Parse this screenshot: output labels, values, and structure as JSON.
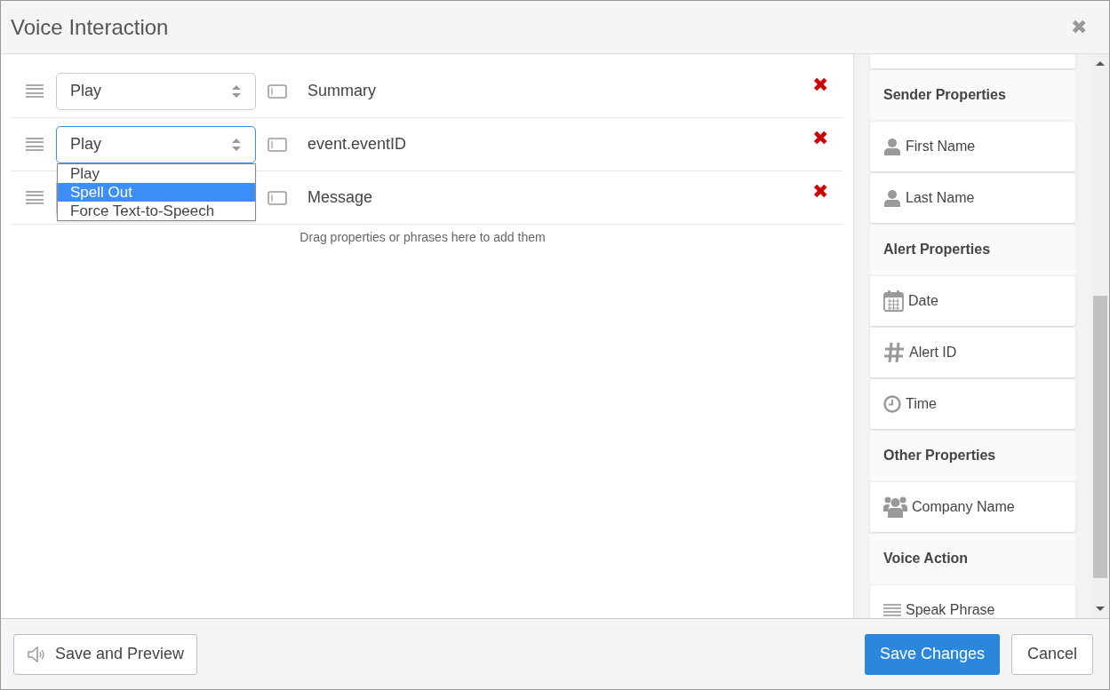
{
  "window": {
    "title": "Voice Interaction",
    "close": "✖"
  },
  "rows": [
    {
      "mode": "Play",
      "field": "Summary",
      "focused": false,
      "remove": "✖"
    },
    {
      "mode": "Play",
      "field": "event.eventID",
      "focused": true,
      "remove": "✖",
      "dropdown": [
        {
          "label": "Play",
          "selected": false
        },
        {
          "label": "Spell Out",
          "selected": true
        },
        {
          "label": "Force Text-to-Speech",
          "selected": false
        }
      ]
    },
    {
      "field": "Message",
      "focused": false,
      "remove": "✖"
    }
  ],
  "drop_hint": "Drag properties or phrases here to add them",
  "sidebar": {
    "groups": [
      {
        "title": "Sender Properties",
        "items": [
          {
            "label": "First Name",
            "kind": "person"
          },
          {
            "label": "Last Name",
            "kind": "person"
          }
        ]
      },
      {
        "title": "Alert Properties",
        "items": [
          {
            "label": "Date",
            "kind": "calendar"
          },
          {
            "label": "Alert ID",
            "kind": "hash"
          },
          {
            "label": "Time",
            "kind": "clock"
          }
        ]
      },
      {
        "title": "Other Properties",
        "items": [
          {
            "label": "Company Name",
            "kind": "group"
          }
        ]
      },
      {
        "title": "Voice Action",
        "items": [
          {
            "label": "Speak Phrase",
            "kind": "lines"
          }
        ]
      }
    ]
  },
  "footer": {
    "preview_button": "Save and Preview",
    "save_button": "Save Changes",
    "cancel_button": "Cancel"
  }
}
